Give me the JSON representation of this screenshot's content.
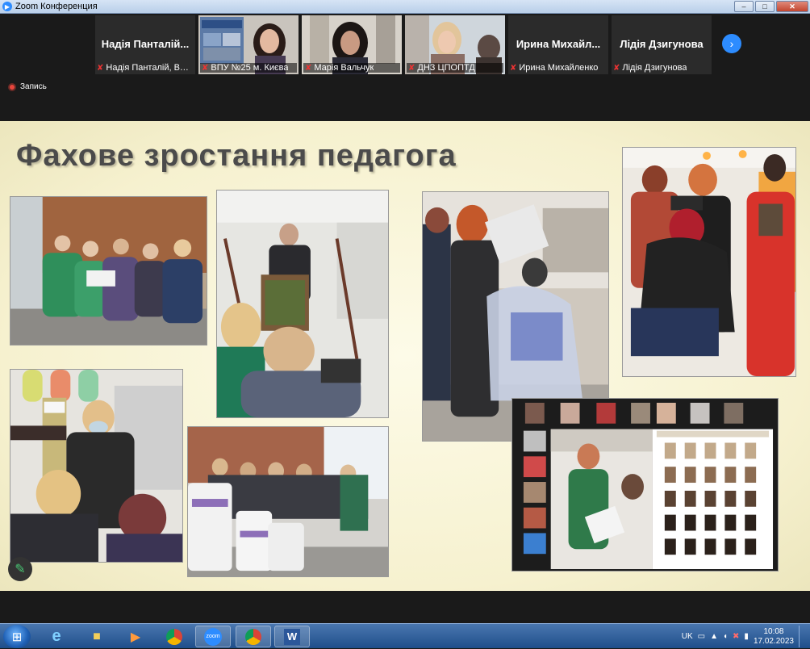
{
  "window": {
    "title": "Zoom Конференция",
    "controls": {
      "minimize": "–",
      "maximize": "□",
      "close": "✕"
    }
  },
  "participants": [
    {
      "big_name": "Надія Панталій...",
      "label": "Надія Панталій, Вищ...",
      "video": false
    },
    {
      "big_name": "",
      "label": "ВПУ №25 м. Києва",
      "video": true,
      "active": true
    },
    {
      "big_name": "",
      "label": "Марія Вальчук",
      "video": true
    },
    {
      "big_name": "",
      "label": "ДНЗ ЦПОПТД",
      "video": true
    },
    {
      "big_name": "Ирина Михайл...",
      "label": "Ирина Михайленко",
      "video": false
    },
    {
      "big_name": "Лідія Дзигунова",
      "label": "Лідія Дзигунова",
      "video": false
    }
  ],
  "icons": {
    "mute": "mic-muted-icon",
    "next": "chevron-right-icon",
    "pencil": "pencil-icon"
  },
  "next_glyph": "›",
  "record_label": "Запись",
  "slide": {
    "title": "Фахове зростання педагога"
  },
  "taskbar": {
    "start_glyph": "⊞",
    "language": "UK",
    "time": "10:08",
    "date": "17.02.2023"
  },
  "colors": {
    "accent": "#2d8cff",
    "muted": "#e33333",
    "active_speaker": "#3ec46d",
    "slide_bg": "#f6f1cf"
  }
}
